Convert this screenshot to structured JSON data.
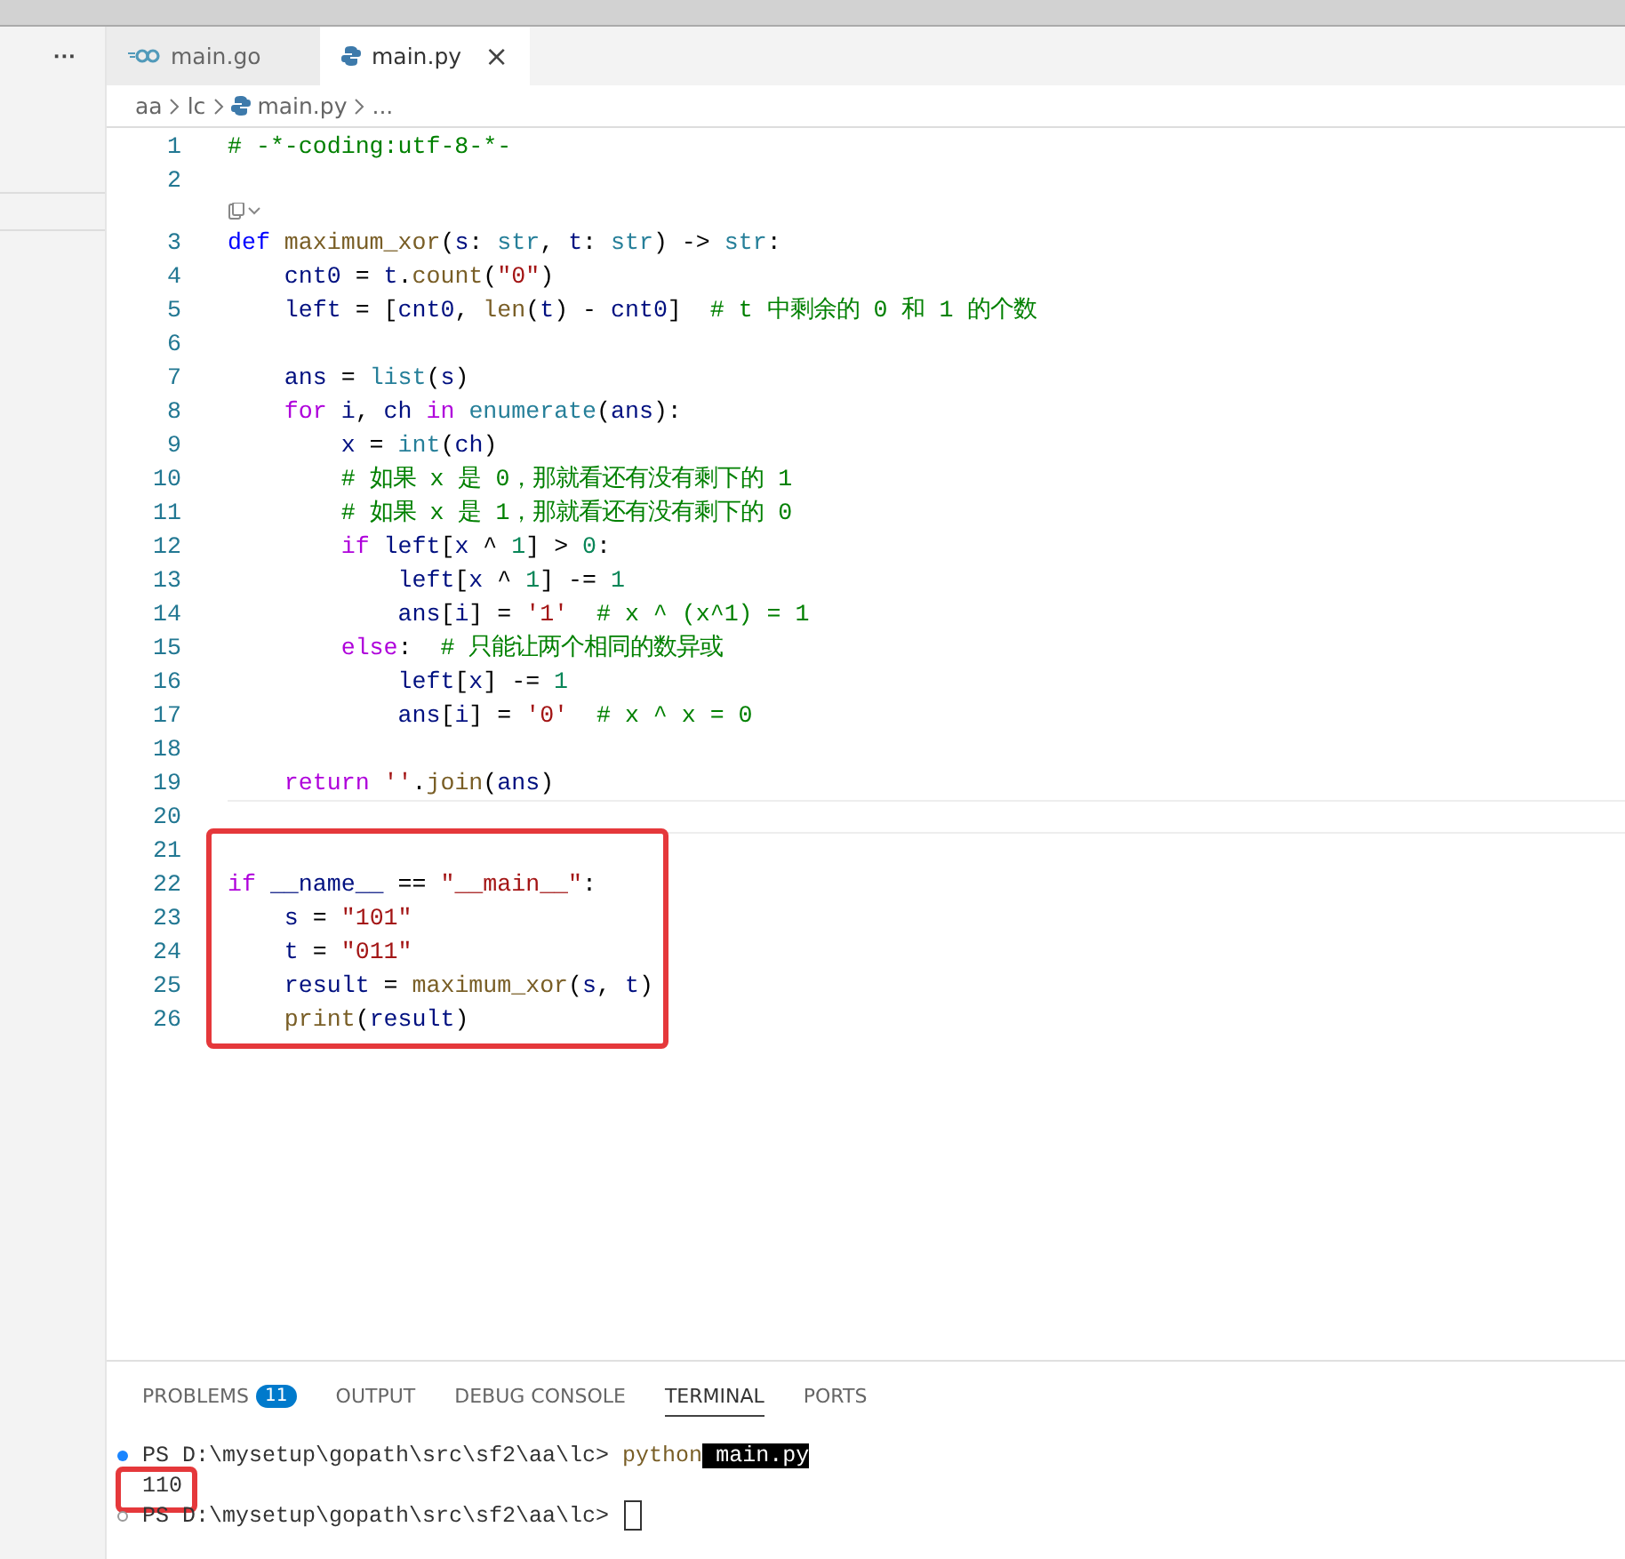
{
  "sidebar": {
    "more": "···"
  },
  "tabs": [
    {
      "label": "main.go",
      "kind": "go",
      "selected": false
    },
    {
      "label": "main.py",
      "kind": "python",
      "selected": true,
      "close": "×"
    }
  ],
  "breadcrumb": [
    {
      "label": "aa",
      "kind": "folder"
    },
    {
      "label": "lc",
      "kind": "folder"
    },
    {
      "label": "main.py",
      "kind": "python"
    },
    {
      "label": "...",
      "kind": "more"
    }
  ],
  "code": {
    "lines": [
      {
        "number": "1",
        "tokens": [
          {
            "t": "# -*-coding:utf-8-*-",
            "kind": "comment"
          }
        ]
      },
      {
        "number": "2"
      },
      {
        "number": "3",
        "codelens": true,
        "tokens": [
          {
            "t": "def ",
            "kind": "keyword"
          },
          {
            "t": "maximum_xor",
            "kind": "function"
          },
          {
            "t": "(",
            "kind": "plain"
          },
          {
            "t": "s",
            "kind": "variable"
          },
          {
            "t": ": ",
            "kind": "plain"
          },
          {
            "t": "str",
            "kind": "type"
          },
          {
            "t": ", ",
            "kind": "plain"
          },
          {
            "t": "t",
            "kind": "variable"
          },
          {
            "t": ": ",
            "kind": "plain"
          },
          {
            "t": "str",
            "kind": "type"
          },
          {
            "t": ") -> ",
            "kind": "plain"
          },
          {
            "t": "str",
            "kind": "type"
          },
          {
            "t": ":",
            "kind": "plain"
          }
        ]
      },
      {
        "number": "4",
        "tokens": [
          {
            "t": "    cnt0",
            "kind": "variable"
          },
          {
            "t": " = ",
            "kind": "plain"
          },
          {
            "t": "t",
            "kind": "variable"
          },
          {
            "t": ".",
            "kind": "plain"
          },
          {
            "t": "count",
            "kind": "function"
          },
          {
            "t": "(",
            "kind": "plain"
          },
          {
            "t": "\"0\"",
            "kind": "string"
          },
          {
            "t": ")",
            "kind": "plain"
          }
        ]
      },
      {
        "number": "5",
        "tokens": [
          {
            "t": "    left",
            "kind": "variable"
          },
          {
            "t": " = [",
            "kind": "plain"
          },
          {
            "t": "cnt0",
            "kind": "variable"
          },
          {
            "t": ", ",
            "kind": "plain"
          },
          {
            "t": "len",
            "kind": "function"
          },
          {
            "t": "(",
            "kind": "plain"
          },
          {
            "t": "t",
            "kind": "variable"
          },
          {
            "t": ") - ",
            "kind": "plain"
          },
          {
            "t": "cnt0",
            "kind": "variable"
          },
          {
            "t": "]",
            "kind": "plain"
          },
          {
            "t": "  # t 中剩余的 0 和 1 的个数",
            "kind": "comment"
          }
        ]
      },
      {
        "number": "6"
      },
      {
        "number": "7",
        "tokens": [
          {
            "t": "    ans",
            "kind": "variable"
          },
          {
            "t": " = ",
            "kind": "plain"
          },
          {
            "t": "list",
            "kind": "type"
          },
          {
            "t": "(",
            "kind": "plain"
          },
          {
            "t": "s",
            "kind": "variable"
          },
          {
            "t": ")",
            "kind": "plain"
          }
        ]
      },
      {
        "number": "8",
        "tokens": [
          {
            "t": "    for ",
            "kind": "control"
          },
          {
            "t": "i",
            "kind": "variable"
          },
          {
            "t": ", ",
            "kind": "plain"
          },
          {
            "t": "ch",
            "kind": "variable"
          },
          {
            "t": " in ",
            "kind": "control"
          },
          {
            "t": "enumerate",
            "kind": "type"
          },
          {
            "t": "(",
            "kind": "plain"
          },
          {
            "t": "ans",
            "kind": "variable"
          },
          {
            "t": "):",
            "kind": "plain"
          }
        ]
      },
      {
        "number": "9",
        "tokens": [
          {
            "t": "        x",
            "kind": "variable"
          },
          {
            "t": " = ",
            "kind": "plain"
          },
          {
            "t": "int",
            "kind": "type"
          },
          {
            "t": "(",
            "kind": "plain"
          },
          {
            "t": "ch",
            "kind": "variable"
          },
          {
            "t": ")",
            "kind": "plain"
          }
        ]
      },
      {
        "number": "10",
        "tokens": [
          {
            "t": "        # 如果 x 是 0，那就看还有没有剩下的 1",
            "kind": "comment"
          }
        ]
      },
      {
        "number": "11",
        "tokens": [
          {
            "t": "        # 如果 x 是 1，那就看还有没有剩下的 0",
            "kind": "comment"
          }
        ]
      },
      {
        "number": "12",
        "tokens": [
          {
            "t": "        if ",
            "kind": "control"
          },
          {
            "t": "left",
            "kind": "variable"
          },
          {
            "t": "[",
            "kind": "plain"
          },
          {
            "t": "x",
            "kind": "variable"
          },
          {
            "t": " ^ ",
            "kind": "plain"
          },
          {
            "t": "1",
            "kind": "number"
          },
          {
            "t": "] > ",
            "kind": "plain"
          },
          {
            "t": "0",
            "kind": "number"
          },
          {
            "t": ":",
            "kind": "plain"
          }
        ]
      },
      {
        "number": "13",
        "tokens": [
          {
            "t": "            left",
            "kind": "variable"
          },
          {
            "t": "[",
            "kind": "plain"
          },
          {
            "t": "x",
            "kind": "variable"
          },
          {
            "t": " ^ ",
            "kind": "plain"
          },
          {
            "t": "1",
            "kind": "number"
          },
          {
            "t": "] -= ",
            "kind": "plain"
          },
          {
            "t": "1",
            "kind": "number"
          }
        ]
      },
      {
        "number": "14",
        "tokens": [
          {
            "t": "            ans",
            "kind": "variable"
          },
          {
            "t": "[",
            "kind": "plain"
          },
          {
            "t": "i",
            "kind": "variable"
          },
          {
            "t": "] = ",
            "kind": "plain"
          },
          {
            "t": "'1'",
            "kind": "string"
          },
          {
            "t": "  # x ^ (x^1) = 1",
            "kind": "comment"
          }
        ]
      },
      {
        "number": "15",
        "tokens": [
          {
            "t": "        else",
            "kind": "control"
          },
          {
            "t": ":",
            "kind": "plain"
          },
          {
            "t": "  # 只能让两个相同的数异或",
            "kind": "comment"
          }
        ]
      },
      {
        "number": "16",
        "tokens": [
          {
            "t": "            left",
            "kind": "variable"
          },
          {
            "t": "[",
            "kind": "plain"
          },
          {
            "t": "x",
            "kind": "variable"
          },
          {
            "t": "] -= ",
            "kind": "plain"
          },
          {
            "t": "1",
            "kind": "number"
          }
        ]
      },
      {
        "number": "17",
        "tokens": [
          {
            "t": "            ans",
            "kind": "variable"
          },
          {
            "t": "[",
            "kind": "plain"
          },
          {
            "t": "i",
            "kind": "variable"
          },
          {
            "t": "] = ",
            "kind": "plain"
          },
          {
            "t": "'0'",
            "kind": "string"
          },
          {
            "t": "  # x ^ x = 0",
            "kind": "comment"
          }
        ]
      },
      {
        "number": "18"
      },
      {
        "number": "19",
        "tokens": [
          {
            "t": "    return ",
            "kind": "control"
          },
          {
            "t": "''",
            "kind": "string"
          },
          {
            "t": ".",
            "kind": "plain"
          },
          {
            "t": "join",
            "kind": "function"
          },
          {
            "t": "(",
            "kind": "plain"
          },
          {
            "t": "ans",
            "kind": "variable"
          },
          {
            "t": ")",
            "kind": "plain"
          }
        ]
      },
      {
        "number": "20",
        "current": true
      },
      {
        "number": "21"
      },
      {
        "number": "22",
        "boxed": true,
        "tokens": [
          {
            "t": "if ",
            "kind": "control"
          },
          {
            "t": "__name__",
            "kind": "variable"
          },
          {
            "t": " == ",
            "kind": "plain"
          },
          {
            "t": "\"__main__\"",
            "kind": "string"
          },
          {
            "t": ":",
            "kind": "plain"
          }
        ]
      },
      {
        "number": "23",
        "boxed": true,
        "tokens": [
          {
            "t": "    s",
            "kind": "variable"
          },
          {
            "t": " = ",
            "kind": "plain"
          },
          {
            "t": "\"101\"",
            "kind": "string"
          }
        ]
      },
      {
        "number": "24",
        "boxed": true,
        "tokens": [
          {
            "t": "    t",
            "kind": "variable"
          },
          {
            "t": " = ",
            "kind": "plain"
          },
          {
            "t": "\"011\"",
            "kind": "string"
          }
        ]
      },
      {
        "number": "25",
        "boxed": true,
        "tokens": [
          {
            "t": "    result",
            "kind": "variable"
          },
          {
            "t": " = ",
            "kind": "plain"
          },
          {
            "t": "maximum_xor",
            "kind": "function"
          },
          {
            "t": "(",
            "kind": "plain"
          },
          {
            "t": "s",
            "kind": "variable"
          },
          {
            "t": ", ",
            "kind": "plain"
          },
          {
            "t": "t",
            "kind": "variable"
          },
          {
            "t": ")",
            "kind": "plain"
          }
        ]
      },
      {
        "number": "26",
        "boxed": true,
        "tokens": [
          {
            "t": "    print",
            "kind": "function"
          },
          {
            "t": "(",
            "kind": "plain"
          },
          {
            "t": "result",
            "kind": "variable"
          },
          {
            "t": ")",
            "kind": "plain"
          }
        ]
      }
    ]
  },
  "panel": {
    "tabs": [
      {
        "label": "PROBLEMS",
        "badge": "11",
        "selected": false
      },
      {
        "label": "OUTPUT",
        "selected": false
      },
      {
        "label": "DEBUG CONSOLE",
        "selected": false
      },
      {
        "label": "TERMINAL",
        "selected": true
      },
      {
        "label": "PORTS",
        "selected": false
      }
    ],
    "terminal": [
      {
        "success": true,
        "tokens": [
          {
            "t": "PS D:\\mysetup\\gopath\\src\\sf2\\aa\\lc> ",
            "kind": "plain"
          },
          {
            "t": "python",
            "kind": "command"
          },
          {
            "t": " main.py",
            "kind": "selection"
          }
        ]
      },
      {
        "boxed": true,
        "tokens": [
          {
            "t": "110",
            "kind": "plain"
          }
        ]
      },
      {
        "success": false,
        "cursor": true,
        "tokens": [
          {
            "t": "PS D:\\mysetup\\gopath\\src\\sf2\\aa\\lc> ",
            "kind": "plain"
          }
        ]
      }
    ]
  }
}
